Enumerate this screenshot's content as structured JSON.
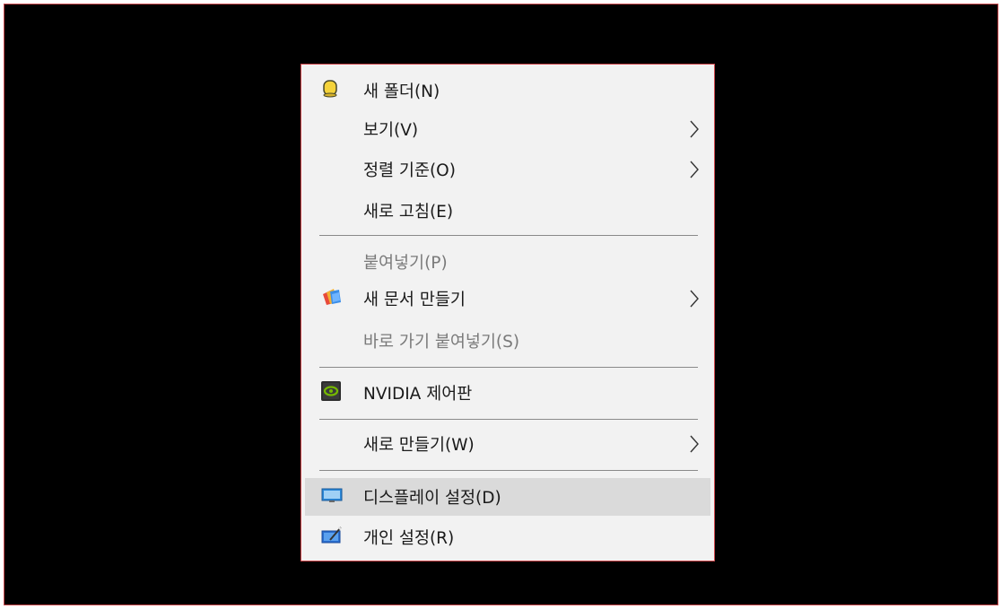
{
  "context_menu": {
    "items": [
      {
        "label": "새 폴더(N)",
        "icon": "new-folder-icon",
        "submenu": false,
        "disabled": false
      },
      {
        "label": "보기(V)",
        "icon": "",
        "submenu": true,
        "disabled": false
      },
      {
        "label": "정렬 기준(O)",
        "icon": "",
        "submenu": true,
        "disabled": false
      },
      {
        "label": "새로 고침(E)",
        "icon": "",
        "submenu": false,
        "disabled": false
      },
      {
        "label": "붙여넣기(P)",
        "icon": "",
        "submenu": false,
        "disabled": true
      },
      {
        "label": "새 문서 만들기",
        "icon": "new-document-icon",
        "submenu": true,
        "disabled": false
      },
      {
        "label": "바로 가기 붙여넣기(S)",
        "icon": "",
        "submenu": false,
        "disabled": true
      },
      {
        "label": "NVIDIA 제어판",
        "icon": "nvidia-icon",
        "submenu": false,
        "disabled": false
      },
      {
        "label": "새로 만들기(W)",
        "icon": "",
        "submenu": true,
        "disabled": false
      },
      {
        "label": "디스플레이 설정(D)",
        "icon": "display-icon",
        "submenu": false,
        "disabled": false,
        "highlighted": true
      },
      {
        "label": "개인 설정(R)",
        "icon": "personalize-icon",
        "submenu": false,
        "disabled": false
      }
    ]
  },
  "colors": {
    "background": "#000000",
    "menu_bg": "#f2f2f2",
    "highlight": "#dadada",
    "border": "#d04a4f",
    "disabled_text": "#7a7a7a"
  }
}
